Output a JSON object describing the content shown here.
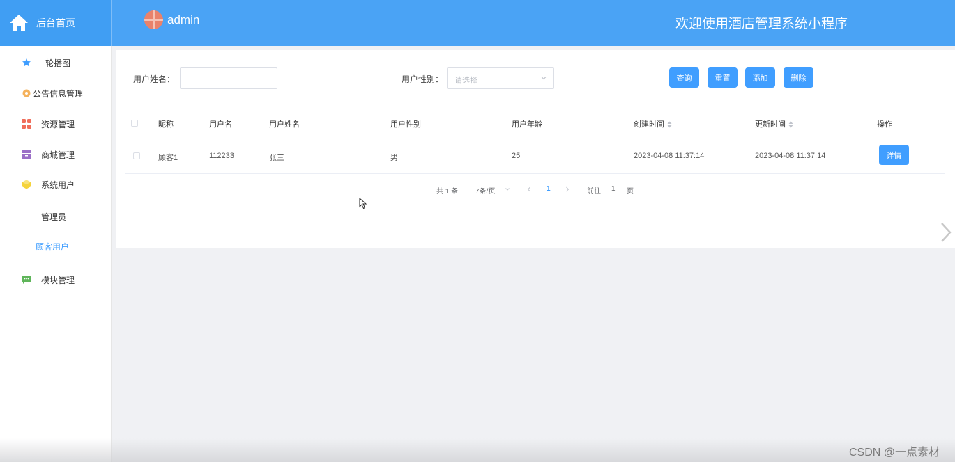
{
  "header": {
    "home_label": "后台首页",
    "username": "admin",
    "system_title": "欢迎使用酒店管理系统小程序"
  },
  "sidebar": {
    "items": [
      {
        "label": "轮播图",
        "icon": "star-icon",
        "color": "#409eff"
      },
      {
        "label": "公告信息管理",
        "icon": "gear-icon",
        "color": "#f5b25c"
      },
      {
        "label": "资源管理",
        "icon": "grid-icon",
        "color": "#f06d5a"
      },
      {
        "label": "商城管理",
        "icon": "box-icon",
        "color": "#9b6fc7"
      },
      {
        "label": "系统用户",
        "icon": "cube-icon",
        "color": "#f5d33b"
      },
      {
        "label": "模块管理",
        "icon": "chat-icon",
        "color": "#5fb55a"
      }
    ],
    "subitems": [
      {
        "label": "管理员",
        "active": false
      },
      {
        "label": "顾客用户",
        "active": true
      }
    ]
  },
  "search": {
    "name_label": "用户姓名：",
    "name_value": "",
    "gender_label": "用户性别：",
    "gender_placeholder": "请选择"
  },
  "toolbar": {
    "query_label": "查询",
    "reset_label": "重置",
    "add_label": "添加",
    "delete_label": "删除"
  },
  "table": {
    "headers": [
      "昵称",
      "用户名",
      "用户姓名",
      "用户性别",
      "用户年龄",
      "创建时间",
      "更新时间",
      "操作"
    ],
    "rows": [
      {
        "nickname": "顾客1",
        "username": "112233",
        "realname": "张三",
        "gender": "男",
        "age": "25",
        "created": "2023-04-08 11:37:14",
        "updated": "2023-04-08 11:37:14",
        "action": "详情"
      }
    ]
  },
  "pagination": {
    "total": "共 1 条",
    "page_size": "7条/页",
    "current_page": "1",
    "goto_label": "前往",
    "goto_value": "1",
    "page_suffix": "页"
  },
  "watermark": "CSDN @一点素材",
  "colors": {
    "header_bg": "#4aa3f5",
    "accent": "#409eff"
  }
}
